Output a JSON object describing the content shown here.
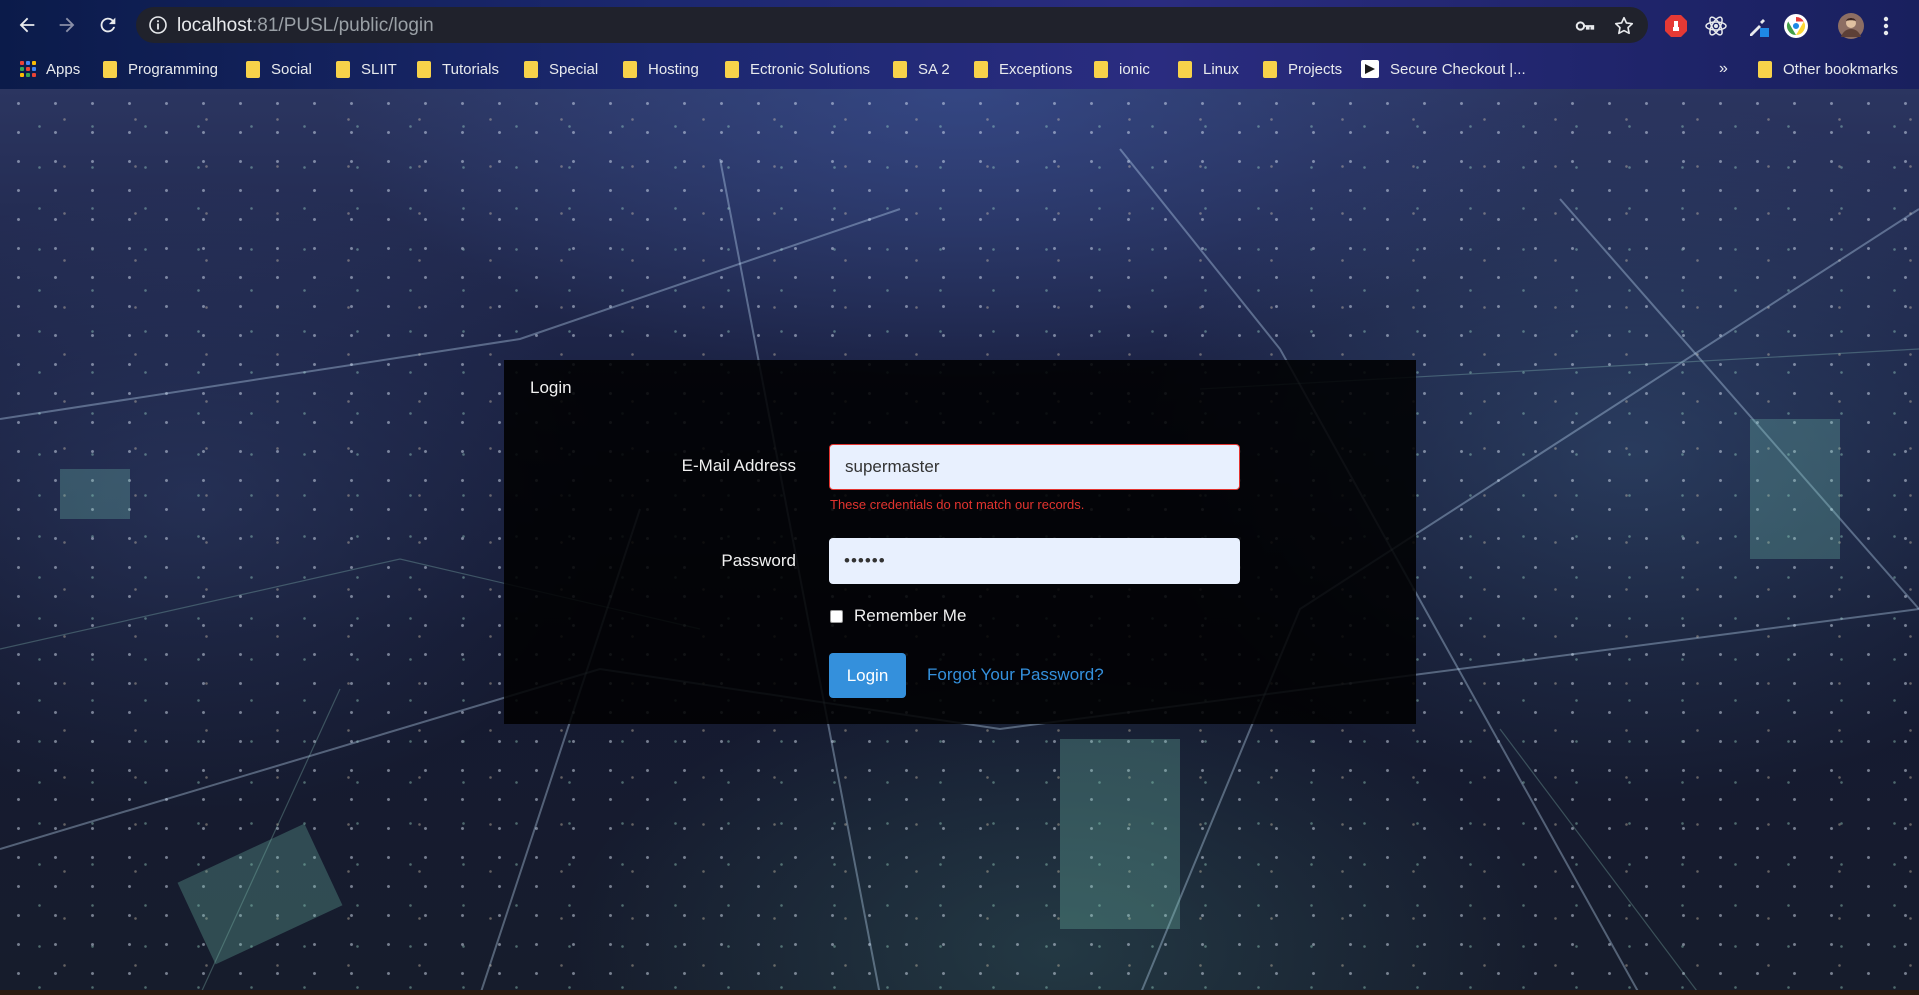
{
  "browser": {
    "url_host": "localhost",
    "url_path": ":81/PUSL/public/login",
    "bookmarks": [
      {
        "label": "Apps",
        "type": "apps"
      },
      {
        "label": "Programming",
        "type": "folder"
      },
      {
        "label": "Social",
        "type": "folder"
      },
      {
        "label": "SLIIT",
        "type": "folder"
      },
      {
        "label": "Tutorials",
        "type": "folder"
      },
      {
        "label": "Special",
        "type": "folder"
      },
      {
        "label": "Hosting",
        "type": "folder"
      },
      {
        "label": "Ectronic Solutions",
        "type": "folder"
      },
      {
        "label": "SA 2",
        "type": "folder"
      },
      {
        "label": "Exceptions",
        "type": "folder"
      },
      {
        "label": "ionic",
        "type": "folder"
      },
      {
        "label": "Linux",
        "type": "folder"
      },
      {
        "label": "Projects",
        "type": "folder"
      },
      {
        "label": "Secure Checkout |...",
        "type": "page"
      }
    ],
    "overflow_label": "»",
    "other_bookmarks": "Other bookmarks",
    "icons": [
      "back-icon",
      "forward-icon",
      "reload-icon",
      "info-icon",
      "key-icon",
      "star-icon",
      "adblock-icon",
      "react-icon",
      "eyedropper-icon",
      "chrome-extension-icon",
      "profile-avatar",
      "more-vert-icon"
    ]
  },
  "login": {
    "title": "Login",
    "email_label": "E-Mail Address",
    "email_value": "supermaster",
    "error": "These credentials do not match our records.",
    "password_label": "Password",
    "password_value": "••••••",
    "remember_label": "Remember Me",
    "submit_label": "Login",
    "forgot_label": "Forgot Your Password?"
  },
  "colors": {
    "primary": "#3490dc",
    "danger": "#e3342f",
    "folder": "#f7d24a"
  }
}
